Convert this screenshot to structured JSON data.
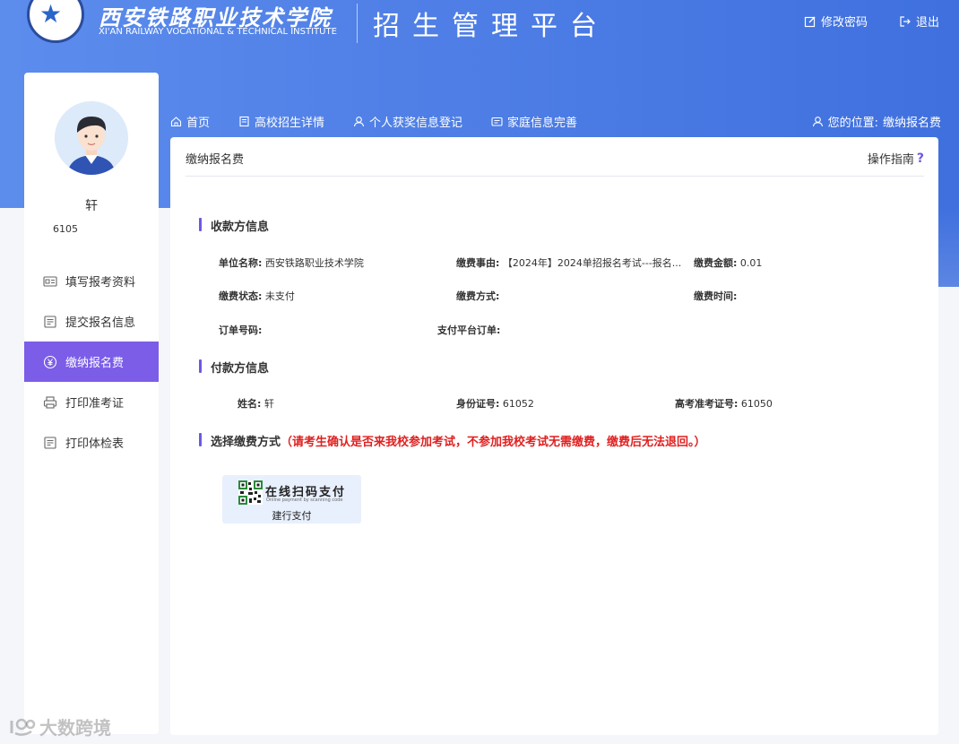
{
  "header": {
    "school_cn": "西安铁路职业技术学院",
    "school_en": "XI'AN RAILWAY VOCATIONAL & TECHNICAL INSTITUTE",
    "platform_title": "招生管理平台",
    "change_password": "修改密码",
    "logout": "退出"
  },
  "sidebar": {
    "user_name": "轩",
    "user_id": "6105",
    "items": [
      {
        "label": "填写报考资料",
        "icon": "id-card-icon"
      },
      {
        "label": "提交报名信息",
        "icon": "document-icon"
      },
      {
        "label": "缴纳报名费",
        "icon": "yen-icon",
        "active": true
      },
      {
        "label": "打印准考证",
        "icon": "printer-icon"
      },
      {
        "label": "打印体检表",
        "icon": "document-icon"
      }
    ]
  },
  "nav": {
    "items": [
      {
        "label": "首页",
        "icon": "home-icon"
      },
      {
        "label": "高校招生详情",
        "icon": "book-icon"
      },
      {
        "label": "个人获奖信息登记",
        "icon": "user-icon"
      },
      {
        "label": "家庭信息完善",
        "icon": "card-icon"
      }
    ],
    "location_label": "您的位置:",
    "location_value": "缴纳报名费"
  },
  "main": {
    "title": "缴纳报名费",
    "guide": "操作指南",
    "guide_mark": "?",
    "payee_section": "收款方信息",
    "payee": {
      "unit_label": "单位名称:",
      "unit_value": "西安铁路职业技术学院",
      "reason_label": "缴费事由:",
      "reason_value": "【2024年】2024单招报名考试---报名...",
      "amount_label": "缴费金额:",
      "amount_value": "0.01",
      "status_label": "缴费状态:",
      "status_value": "未支付",
      "method_label": "缴费方式:",
      "method_value": "",
      "time_label": "缴费时间:",
      "time_value": "",
      "order_label": "订单号码:",
      "order_value": "",
      "platform_order_label": "支付平台订单:",
      "platform_order_value": ""
    },
    "payer_section": "付款方信息",
    "payer": {
      "name_label": "姓名:",
      "name_value": "轩",
      "id_label": "身份证号:",
      "id_value": "61052",
      "exam_label": "高考准考证号:",
      "exam_value": "61050"
    },
    "method_section": "选择缴费方式",
    "method_warning": "（请考生确认是否来我校参加考试，不参加我校考试无需缴费，缴费后无法退回。）",
    "pay_button": {
      "main": "在线扫码支付",
      "sub": "Online payment by scanning code",
      "label": "建行支付"
    }
  },
  "watermark": "大数跨境",
  "colors": {
    "header_blue": "#4f7fe6",
    "accent_purple": "#6a5ae0",
    "active_menu": "#7b5de8",
    "warning_red": "#e02020"
  }
}
